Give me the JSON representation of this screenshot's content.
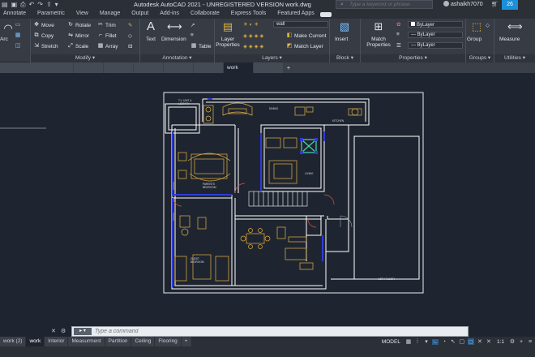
{
  "window": {
    "title": "Autodesk AutoCAD 2021 - UNREGISTERED VERSION    work.dwg",
    "search_placeholder": "Type a keyword or phrase",
    "user": "ashaikh7070",
    "info_badge": "26"
  },
  "menu": {
    "tabs": [
      "Annotate",
      "Parametric",
      "View",
      "Manage",
      "Output",
      "Add-ins",
      "Collaborate",
      "Express Tools",
      "Featured Apps"
    ]
  },
  "ribbon": {
    "draw": {
      "arc_label": "Arc"
    },
    "modify": {
      "title": "Modify",
      "items": [
        "Move",
        "Rotate",
        "Trim",
        "Copy",
        "Mirror",
        "Fillet",
        "Stretch",
        "Scale",
        "Array"
      ]
    },
    "annotation": {
      "title": "Annotation",
      "text_label": "Text",
      "dimension_label": "Dimension",
      "table_label": "Table"
    },
    "layers": {
      "title": "Layers",
      "layer_properties_label": "Layer Properties",
      "current_layer": "wall",
      "make_current_label": "Make Current",
      "match_layer_label": "Match Layer"
    },
    "block": {
      "title": "Block",
      "insert_label": "Insert"
    },
    "properties": {
      "title": "Properties",
      "match_label": "Match Properties",
      "color_value": "ByLayer",
      "linetype_value": "ByLayer",
      "lineweight_value": "ByLayer"
    },
    "groups": {
      "title": "Groups",
      "group_label": "Group"
    },
    "utilities": {
      "title": "Utilities",
      "measure_label": "Measure"
    }
  },
  "document_tabs": {
    "tabs": [
      "work"
    ],
    "active": "work"
  },
  "drawing": {
    "labels": {
      "tv_unit": "T.V. UNIT &",
      "library": "LIBRARY",
      "dining": "DINING",
      "kitchen": "KITCHEN",
      "parents_bedroom": "PARENTS",
      "bedroom": "BEDROOM",
      "living": "LIVING",
      "guest": "GUEST",
      "guest_bedroom": "BEDROOM",
      "floor": "10TH FLOOR"
    }
  },
  "command_line": {
    "placeholder": "Type a command"
  },
  "layout_tabs": {
    "tabs": [
      "work (2)",
      "work",
      "Interior",
      "Measurment",
      "Partition",
      "Ceiling",
      "Flooring"
    ],
    "active": "work",
    "add": "+"
  },
  "status": {
    "model_label": "MODEL",
    "scale": "1:1"
  },
  "colors": {
    "accent": "#1b8fd8",
    "background": "#1f2530",
    "ribbon": "#363b44",
    "wall": "#ffffff",
    "furniture": "#e3b341",
    "blue_outline": "#2f3bd6"
  }
}
